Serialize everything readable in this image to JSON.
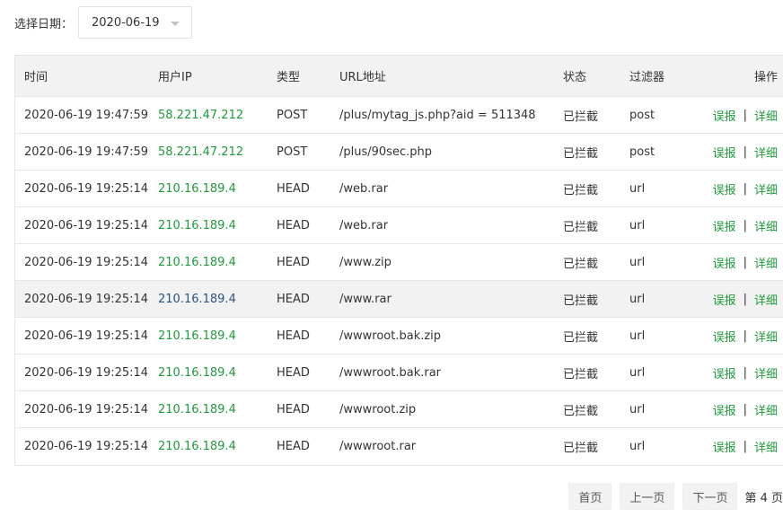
{
  "filter": {
    "label": "选择日期：",
    "date_value": "2020-06-19"
  },
  "table": {
    "headers": {
      "time": "时间",
      "ip": "用户IP",
      "type": "类型",
      "url": "URL地址",
      "status": "状态",
      "filter": "过滤器",
      "ops": "操作"
    },
    "rows": [
      {
        "time": "2020-06-19 19:47:59",
        "ip": "58.221.47.212",
        "type": "POST",
        "url": "/plus/mytag_js.php?aid = 511348",
        "status": "已拦截",
        "filter": "post",
        "report": "误报",
        "sep": "|",
        "detail": "详细"
      },
      {
        "time": "2020-06-19 19:47:59",
        "ip": "58.221.47.212",
        "type": "POST",
        "url": "/plus/90sec.php",
        "status": "已拦截",
        "filter": "post",
        "report": "误报",
        "sep": "|",
        "detail": "详细"
      },
      {
        "time": "2020-06-19 19:25:14",
        "ip": "210.16.189.4",
        "type": "HEAD",
        "url": "/web.rar",
        "status": "已拦截",
        "filter": "url",
        "report": "误报",
        "sep": "|",
        "detail": "详细"
      },
      {
        "time": "2020-06-19 19:25:14",
        "ip": "210.16.189.4",
        "type": "HEAD",
        "url": "/web.rar",
        "status": "已拦截",
        "filter": "url",
        "report": "误报",
        "sep": "|",
        "detail": "详细"
      },
      {
        "time": "2020-06-19 19:25:14",
        "ip": "210.16.189.4",
        "type": "HEAD",
        "url": "/www.zip",
        "status": "已拦截",
        "filter": "url",
        "report": "误报",
        "sep": "|",
        "detail": "详细"
      },
      {
        "time": "2020-06-19 19:25:14",
        "ip": "210.16.189.4",
        "type": "HEAD",
        "url": "/www.rar",
        "status": "已拦截",
        "filter": "url",
        "report": "误报",
        "sep": "|",
        "detail": "详细"
      },
      {
        "time": "2020-06-19 19:25:14",
        "ip": "210.16.189.4",
        "type": "HEAD",
        "url": "/wwwroot.bak.zip",
        "status": "已拦截",
        "filter": "url",
        "report": "误报",
        "sep": "|",
        "detail": "详细"
      },
      {
        "time": "2020-06-19 19:25:14",
        "ip": "210.16.189.4",
        "type": "HEAD",
        "url": "/wwwroot.bak.rar",
        "status": "已拦截",
        "filter": "url",
        "report": "误报",
        "sep": "|",
        "detail": "详细"
      },
      {
        "time": "2020-06-19 19:25:14",
        "ip": "210.16.189.4",
        "type": "HEAD",
        "url": "/wwwroot.zip",
        "status": "已拦截",
        "filter": "url",
        "report": "误报",
        "sep": "|",
        "detail": "详细"
      },
      {
        "time": "2020-06-19 19:25:14",
        "ip": "210.16.189.4",
        "type": "HEAD",
        "url": "/wwwroot.rar",
        "status": "已拦截",
        "filter": "url",
        "report": "误报",
        "sep": "|",
        "detail": "详细"
      }
    ]
  },
  "pagination": {
    "first": "首页",
    "prev": "上一页",
    "next": "下一页",
    "current": "第 4 页"
  },
  "colors": {
    "link_green": "#1e9b3a",
    "hover_row_bg": "#f2f2f2",
    "border": "#e6e6e6"
  },
  "icons": {
    "date_dropdown": "caret-down-icon"
  }
}
